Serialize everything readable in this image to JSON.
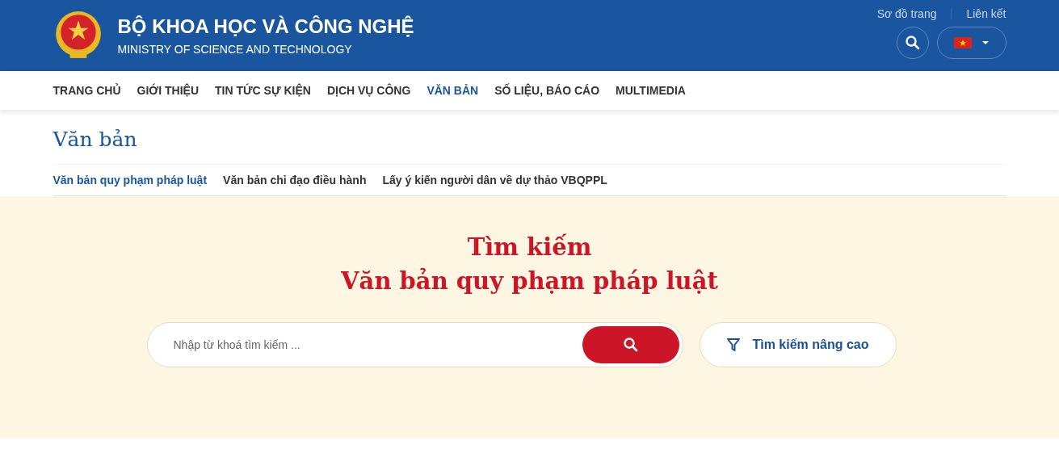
{
  "header": {
    "title": "BỘ KHOA HỌC VÀ CÔNG NGHỆ",
    "subtitle": "MINISTRY OF SCIENCE AND TECHNOLOGY",
    "links": [
      "Sơ đồ trang",
      "Liên kết"
    ]
  },
  "nav": [
    {
      "label": "TRANG CHỦ",
      "selected": false
    },
    {
      "label": "GIỚI THIỆU",
      "selected": false
    },
    {
      "label": "TIN TỨC SỰ KIỆN",
      "selected": false
    },
    {
      "label": "DỊCH VỤ CÔNG",
      "selected": false
    },
    {
      "label": "VĂN BẢN",
      "selected": true
    },
    {
      "label": "SỐ LIỆU, BÁO CÁO",
      "selected": false
    },
    {
      "label": "MULTIMEDIA",
      "selected": false
    }
  ],
  "page_title": "Văn bản",
  "subnav": [
    {
      "label": "Văn bản quy phạm pháp luật",
      "selected": true
    },
    {
      "label": "Văn bản chỉ đạo điều hành",
      "selected": false
    },
    {
      "label": "Lấy ý kiến người dân về dự thảo VBQPPL",
      "selected": false
    }
  ],
  "search": {
    "heading": [
      "Tìm kiếm",
      "Văn bản quy phạm pháp luật"
    ],
    "placeholder": "Nhập từ khoá tìm kiếm ...",
    "advanced": "Tìm kiếm nâng cao"
  }
}
